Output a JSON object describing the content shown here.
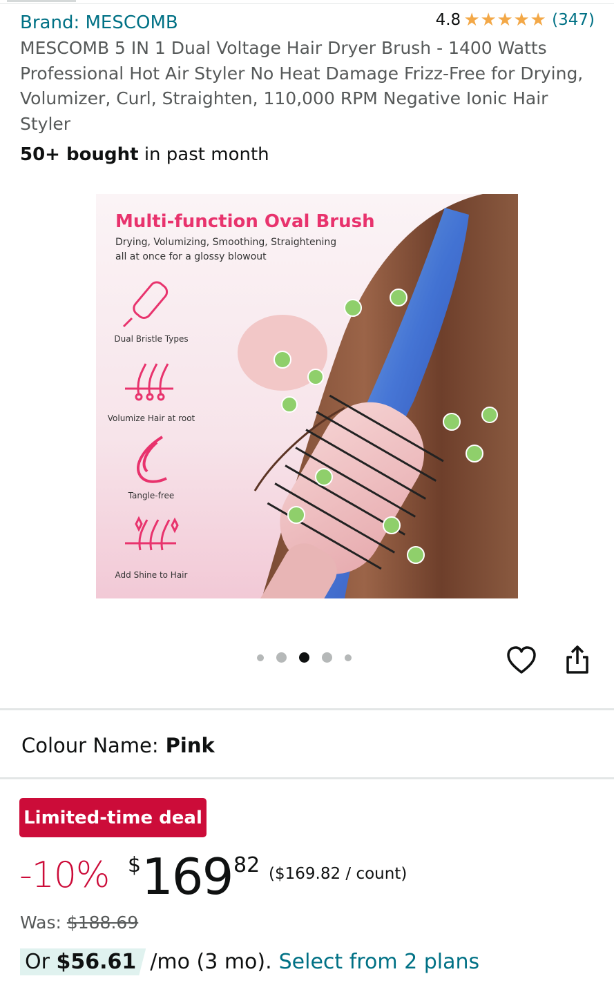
{
  "header": {
    "brand": "Brand: MESCOMB",
    "rating_value": "4.8",
    "rating_stars": 4.8,
    "review_count": "(347)"
  },
  "product": {
    "title": "MESCOMB 5 IN 1 Dual Voltage Hair Dryer Brush - 1400 Watts Professional Hot Air Styler No Heat Damage Frizz-Free for Drying, Volumizer, Curl, Straighten, 110,000 RPM Negative Ionic Hair Styler",
    "bought_bold": "50+ bought",
    "bought_rest": " in past month"
  },
  "image": {
    "heading": "Multi-function Oval Brush",
    "subline_1": "Drying, Volumizing, Smoothing, Straightening",
    "subline_2": "all at once for a glossy blowout",
    "features": [
      {
        "label": "Dual Bristle Types",
        "icon": "brush-icon"
      },
      {
        "label": "Volumize Hair at root",
        "icon": "hair-root-icon"
      },
      {
        "label": "Tangle-free",
        "icon": "curl-icon"
      },
      {
        "label": "Add Shine to Hair",
        "icon": "shine-icon"
      }
    ],
    "carousel_count": 5,
    "carousel_active_index": 2
  },
  "actions": {
    "favorite_icon": "heart-icon",
    "share_icon": "share-icon"
  },
  "variation": {
    "label": "Colour Name:",
    "value": "Pink"
  },
  "pricing": {
    "deal_badge": "Limited-time deal",
    "discount": "-10%",
    "currency": "$",
    "price_whole": "169",
    "price_fraction": "82",
    "unit_price": "($169.82 / count)",
    "was_label": "Was:",
    "was_price": "$188.69",
    "installment_prefix": "Or ",
    "installment_amount": "$56.61",
    "installment_suffix": "/mo (3 mo).",
    "installment_link": "Select from 2 plans"
  },
  "colors": {
    "link": "#007185",
    "deal_red": "#cc0c39",
    "star": "#f3a847",
    "image_accent_pink": "#e8336d"
  }
}
